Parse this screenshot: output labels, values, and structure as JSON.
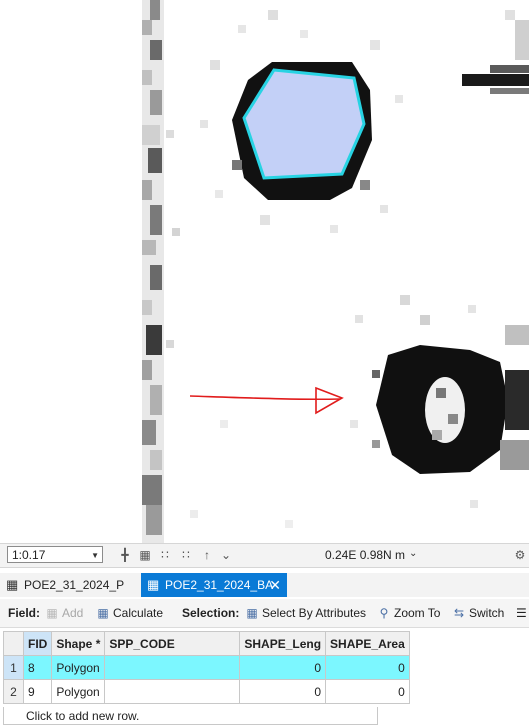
{
  "map": {
    "annotation": "red-hand-drawn-arrow",
    "selected_color": "#c3d0f7",
    "selected_outline": "#27d3e3"
  },
  "statusbar": {
    "scale": "1:0.17",
    "coordinates": "0.24E 0.98N m"
  },
  "tabs": [
    {
      "label": "POE2_31_2024_P",
      "active": false,
      "icon": "table-icon"
    },
    {
      "label": "POE2_31_2024_BA",
      "active": true,
      "icon": "table-icon"
    }
  ],
  "toolbar": {
    "field_label": "Field:",
    "add_label": "Add",
    "calculate_label": "Calculate",
    "selection_label": "Selection:",
    "select_by_attributes_label": "Select By Attributes",
    "zoom_to_label": "Zoom To",
    "switch_label": "Switch"
  },
  "table": {
    "columns": [
      "FID",
      "Shape *",
      "SPP_CODE",
      "SHAPE_Leng",
      "SHAPE_Area"
    ],
    "rows": [
      {
        "rownum": "1",
        "fid": "8",
        "shape": "Polygon",
        "spp_code": "",
        "shape_leng": "0",
        "shape_area": "0",
        "selected": true
      },
      {
        "rownum": "2",
        "fid": "9",
        "shape": "Polygon",
        "spp_code": "",
        "shape_leng": "0",
        "shape_area": "0",
        "selected": false
      }
    ],
    "add_row_text": "Click to add new row."
  }
}
